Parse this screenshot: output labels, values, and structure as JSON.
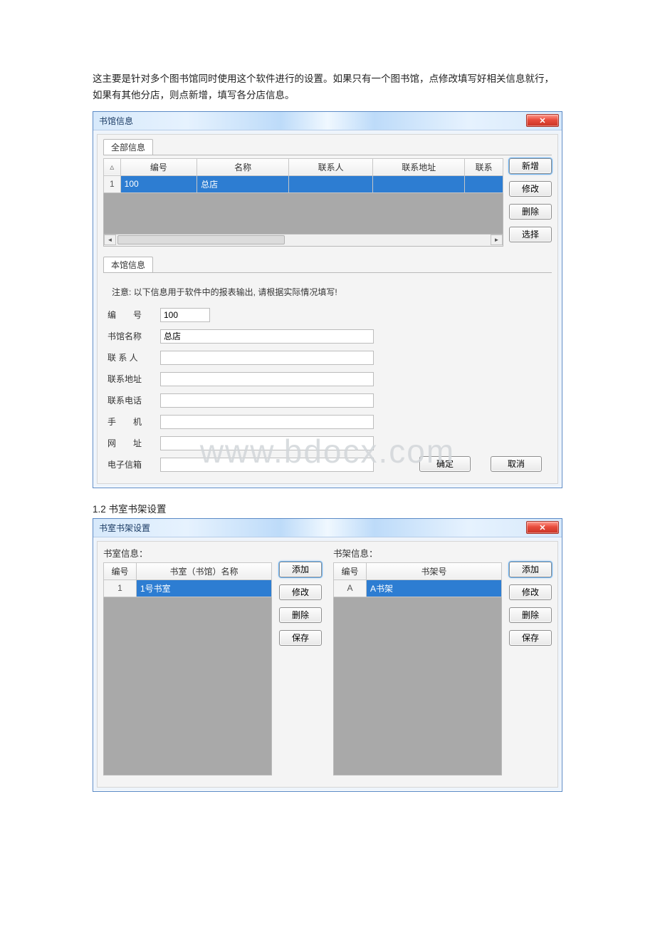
{
  "intro_text": "这主要是针对多个图书馆同时使用这个软件进行的设置。如果只有一个图书馆，点修改填写好相关信息就行，如果有其他分店，则点新增，填写各分店信息。",
  "section_1_2": "1.2 书室书架设置",
  "watermark": "www.bdocx.com",
  "win1": {
    "title": "书馆信息",
    "close": "✕",
    "tab_all": "全部信息",
    "headers": {
      "sort": "▵",
      "code": "编号",
      "name": "名称",
      "contact": "联系人",
      "address": "联系地址",
      "phone": "联系"
    },
    "rows": [
      {
        "num": "1",
        "code": "100",
        "name": "总店",
        "contact": "",
        "address": "",
        "phone": ""
      }
    ],
    "buttons": {
      "add": "新增",
      "edit": "修改",
      "delete": "删除",
      "select": "选择"
    },
    "tab_local": "本馆信息",
    "notice": "注意: 以下信息用于软件中的报表输出, 请根据实际情况填写!",
    "form": {
      "code_label": "编　　号",
      "code_value": "100",
      "name_label": "书馆名称",
      "name_value": "总店",
      "contact_label": "联 系 人",
      "contact_value": "",
      "address_label": "联系地址",
      "address_value": "",
      "phone_label": "联系电话",
      "phone_value": "",
      "mobile_label": "手　　机",
      "mobile_value": "",
      "url_label": "网　　址",
      "url_value": "",
      "email_label": "电子信箱",
      "email_value": "",
      "ok": "确定",
      "cancel": "取消"
    }
  },
  "win2": {
    "title": "书室书架设置",
    "close": "✕",
    "room_title": "书室信息：",
    "shelf_title": "书架信息：",
    "room_headers": {
      "code": "编号",
      "name": "书室（书馆）名称"
    },
    "shelf_headers": {
      "code": "编号",
      "name": "书架号"
    },
    "room_rows": [
      {
        "num": "1",
        "code": "",
        "name": "1号书室"
      }
    ],
    "shelf_rows": [
      {
        "num": "A",
        "code": "",
        "name": "A书架"
      }
    ],
    "buttons": {
      "add": "添加",
      "edit": "修改",
      "delete": "删除",
      "save": "保存"
    }
  }
}
